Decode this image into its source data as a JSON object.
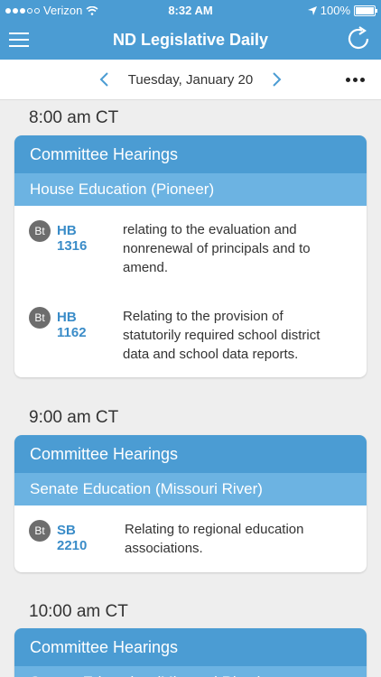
{
  "status": {
    "carrier": "Verizon",
    "time": "8:32 AM",
    "battery": "100%"
  },
  "nav": {
    "title": "ND Legislative Daily"
  },
  "datebar": {
    "date": "Tuesday, January 20"
  },
  "sections": [
    {
      "time": "8:00 am CT",
      "category": "Committee Hearings",
      "committee": "House Education (Pioneer)",
      "bills": [
        {
          "badge": "Bt",
          "number": "HB 1316",
          "description": [
            "relating to the evaluation and",
            "nonrenewal of principals and to",
            "amend."
          ]
        },
        {
          "badge": "Bt",
          "number": "HB 1162",
          "description": [
            "Relating to the provision of",
            "statutorily required school district",
            "data and school data reports."
          ]
        }
      ]
    },
    {
      "time": "9:00 am CT",
      "category": "Committee Hearings",
      "committee": "Senate Education (Missouri River)",
      "bills": [
        {
          "badge": "Bt",
          "number": "SB 2210",
          "description": [
            "Relating to regional education",
            "associations."
          ]
        }
      ]
    },
    {
      "time": "10:00 am CT",
      "category": "Committee Hearings",
      "committee": "Senate Education (Missouri River)"
    }
  ]
}
